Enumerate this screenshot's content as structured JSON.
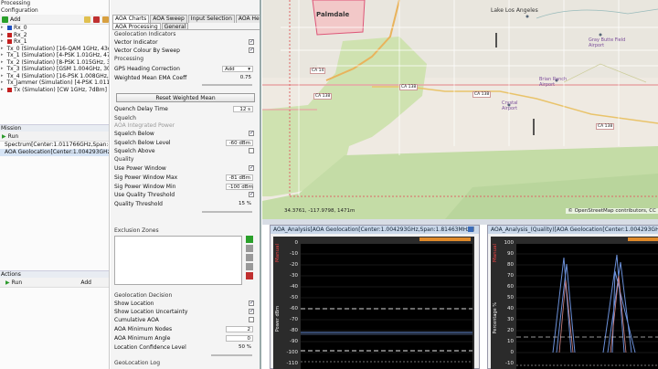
{
  "left": {
    "processing_title": "Processing",
    "configuration_title": "Configuration",
    "toolbar_add": "Add",
    "signals": [
      {
        "label": "Rx_0",
        "color": "#1e4fbf"
      },
      {
        "label": "Rx_2",
        "color": "#c42020"
      },
      {
        "label": "Rx_1",
        "color": "#c42020"
      },
      {
        "label": "Tx_0 (Simulation) [16-QAM 1GHz, 43dB",
        "color": "#c42020"
      },
      {
        "label": "Tx_1 (Simulation) [4-PSK 1.01GHz, 47d",
        "color": "#c42020"
      },
      {
        "label": "Tx_2 (Simulation) [8-PSK 1.015GHz, 38",
        "color": "#c42020"
      },
      {
        "label": "Tx_3 (Simulation) [GSM 1.004GHz, 30d",
        "color": "#c42020"
      },
      {
        "label": "Tx_4 (Simulation) [16-PSK 1.008GHz, 3",
        "color": "#c42020"
      },
      {
        "label": "Tx_Jammer (Simulation) [4-PSK 1.0115",
        "color": "#20a020"
      },
      {
        "label": "Tx (Simulation) [CW 1GHz, 7dBm]",
        "color": "#c42020"
      }
    ],
    "mission_title": "Mission",
    "run_label": "Run",
    "missions": [
      "Spectrum[Center:1.011766GHz,Span:41.97",
      "AOA Geolocation[Center:1.004293GHz,Span:"
    ],
    "actions_title": "Actions",
    "actions_run": "Run",
    "actions_add": "Add"
  },
  "middle": {
    "tabs_top": [
      "AOA Charts",
      "AOA Sweep",
      "Input Selection",
      "AOA HeatMap"
    ],
    "tabs_sub": [
      "AOA Processing",
      "General"
    ],
    "geolocation_indicators": "Geolocation Indicators",
    "vector_indicator": "Vector Indicator",
    "vector_colour": "Vector Colour By Sweep",
    "processing": "Processing",
    "gps_heading": "GPS Heading Correction",
    "gps_value": "Add",
    "weighted_mean": "Weighted Mean EMA Coeff",
    "weighted_value": "0.75",
    "reset_button": "Reset Weighted Mean",
    "quench_delay": "Quench Delay Time",
    "quench_value": "12 s",
    "squelch": "Squelch",
    "aoa_integrated": "AOA Integrated Power",
    "squelch_below": "Squelch Below",
    "squelch_below_level": "Squelch Below Level",
    "squelch_level_value": "-60 dBm",
    "squelch_above": "Squelch Above",
    "quality": "Quality",
    "use_power_window": "Use Power Window",
    "sig_power_max": "Sig Power Window Max",
    "sig_max_value": "-81 dBm",
    "sig_power_min": "Sig Power Window Min",
    "sig_min_value": "-100 dBm",
    "use_quality_threshold": "Use Quality Threshold",
    "quality_threshold": "Quality Threshold",
    "quality_value": "15 %",
    "exclusion_zones": "Exclusion Zones",
    "geolocation_decision": "Geolocation Decision",
    "show_location": "Show Location",
    "show_uncertainty": "Show Location Uncertainty",
    "cumulative_aoa": "Cumulative AOA",
    "aoa_min_nodes": "AOA Minimum Nodes",
    "min_nodes_value": "2",
    "aoa_min_angle": "AOA Minimum Angle",
    "min_angle_value": "0",
    "location_confidence": "Location Confidence Level",
    "confidence_value": "50 %",
    "geolocation_log": "GeoLocation Log"
  },
  "map": {
    "places": [
      "Palmdale",
      "Lake Los Angeles",
      "Gray Butte Field Airport",
      "Brian Ranch Airport",
      "Crystal Airport"
    ],
    "roads": [
      "CA 14",
      "CA 138",
      "CA 138",
      "CA 138",
      "CA 138"
    ],
    "coords": "34.3761, -117.9798, 1471m",
    "attribution": "© OpenStreetMap contributors, CC"
  },
  "chart_left": {
    "title": "AOA_Analysis[AOA Geolocation[Center:1.004293GHz,Span:1.81463MHz]]",
    "side_label": "Manual",
    "ylabel": "Power dBm",
    "yticks": [
      "0",
      "-10",
      "-20",
      "-30",
      "-40",
      "-50",
      "-60",
      "-70",
      "-80",
      "-90",
      "-100",
      "-110"
    ]
  },
  "chart_right": {
    "title": "AOA_Analysis_(Quality)[AOA Geolocation[Center:1.004293GHz,Spa",
    "side_label": "Manual",
    "ylabel": "Percentage %",
    "yticks": [
      "100",
      "90",
      "80",
      "70",
      "60",
      "50",
      "40",
      "30",
      "20",
      "10",
      "0",
      "-10"
    ]
  }
}
